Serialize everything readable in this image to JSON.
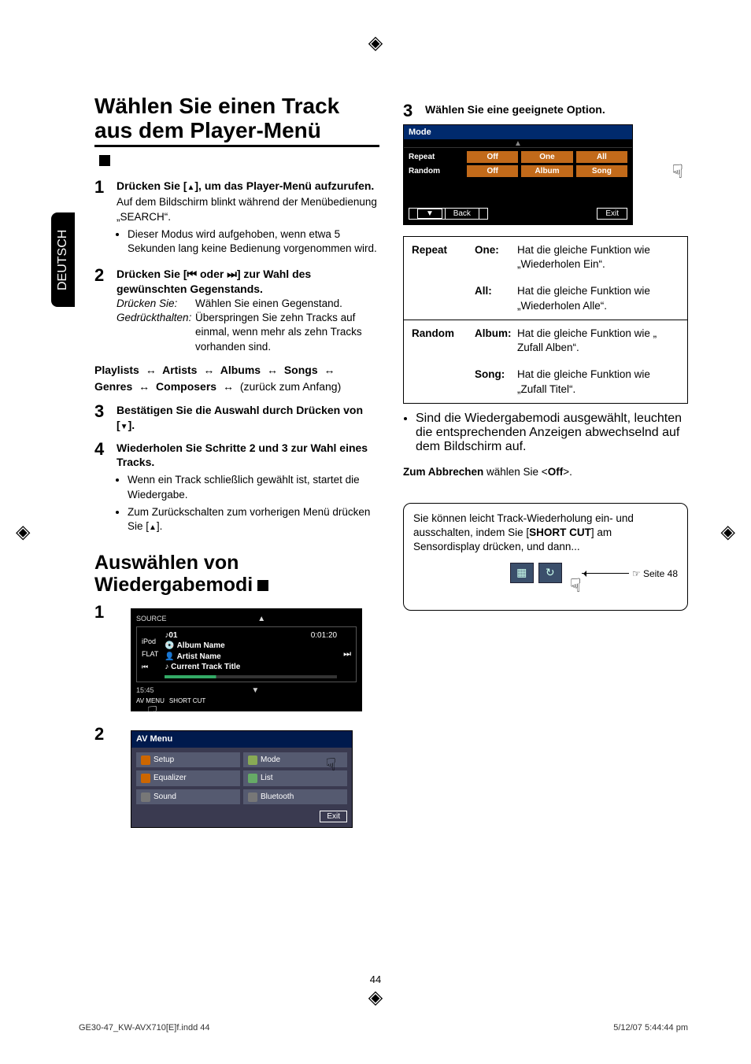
{
  "sideTab": "DEUTSCH",
  "left": {
    "h1": "Wählen Sie einen Track aus dem Player-Menü",
    "s1": {
      "lead_before": "Drücken Sie [",
      "lead_after": "], um das Player-Menü aufzurufen.",
      "sub": "Auf dem Bildschirm blinkt während der Menübedienung „SEARCH“.",
      "bullet": "Dieser Modus wird aufgehoben, wenn etwa 5 Sekunden lang keine Bedienung vorgenommen wird."
    },
    "s2": {
      "lead_a": "Drücken Sie [",
      "lead_b": " oder ",
      "lead_c": "] zur Wahl des gewünschten Gegenstands.",
      "defs": {
        "k1": "Drücken Sie",
        "v1": "Wählen Sie einen Gegenstand.",
        "k2": "Gedrückthalten",
        "v2": "Überspringen Sie zehn Tracks auf einmal, wenn mehr als zehn Tracks vorhanden sind."
      }
    },
    "chain": {
      "items": [
        "Playlists",
        "Artists",
        "Albums",
        "Songs",
        "Genres",
        "Composers"
      ],
      "tail": "(zurück zum Anfang)"
    },
    "s3": {
      "lead_a": "Bestätigen Sie die Auswahl durch Drücken von [",
      "lead_b": "]."
    },
    "s4": {
      "lead": "Wiederholen Sie Schritte 2 und 3 zur Wahl eines Tracks.",
      "b1": "Wenn ein Track schließlich gewählt ist, startet die Wiedergabe.",
      "b2_a": "Zum Zurückschalten zum vorherigen Menü drücken Sie [",
      "b2_b": "]."
    },
    "h2": "Auswählen von Wiedergabemodi",
    "shot1": {
      "source": "SOURCE",
      "ipod": "iPod",
      "flat": "FLAT",
      "tracknum": "01",
      "time": "0:01:20",
      "album": "Album Name",
      "artist": "Artist Name",
      "title": "Current Track Title",
      "clock": "15:45",
      "menu": "AV MENU",
      "short": "SHORT CUT"
    },
    "shot2": {
      "title": "AV Menu",
      "items": [
        "Setup",
        "Mode",
        "Equalizer",
        "List",
        "Sound",
        "Bluetooth"
      ],
      "exit": "Exit"
    }
  },
  "right": {
    "s3lead": "Wählen Sie eine geeignete Option.",
    "mode": {
      "title": "Mode",
      "rowRepeat": {
        "label": "Repeat",
        "opts": [
          "Off",
          "One",
          "All"
        ]
      },
      "rowRandom": {
        "label": "Random",
        "opts": [
          "Off",
          "Album",
          "Song"
        ]
      },
      "back": "Back",
      "exit": "Exit"
    },
    "table": {
      "repeat": {
        "label": "Repeat",
        "r1k": "One",
        "r1v": "Hat die gleiche Funktion wie „Wiederholen Ein“.",
        "r2k": "All",
        "r2v": "Hat die gleiche Funktion wie „Wiederholen Alle“."
      },
      "random": {
        "label": "Random",
        "r1k": "Album",
        "r1v": "Hat die gleiche Funktion wie „ Zufall Alben“.",
        "r2k": "Song",
        "r2v": "Hat die gleiche Funktion wie „Zufall Titel“."
      }
    },
    "bullet": "Sind die Wiedergabemodi ausgewählt, leuchten die entsprechenden Anzeigen abwechselnd auf dem Bildschirm auf.",
    "cancel_a": "Zum Abbrechen",
    "cancel_b": " wählen Sie <",
    "cancel_c": "Off",
    "cancel_d": ">.",
    "callout_a": "Sie können leicht Track-Wiederholung ein- und ausschalten, indem Sie [",
    "callout_b": "SHORT CUT",
    "callout_c": "] am Sensordisplay drücken, und dann...",
    "seite": "☞ Seite 48"
  },
  "pagenum": "44",
  "footer": {
    "file": "GE30-47_KW-AVX710[E]f.indd   44",
    "date": "5/12/07   5:44:44 pm"
  }
}
